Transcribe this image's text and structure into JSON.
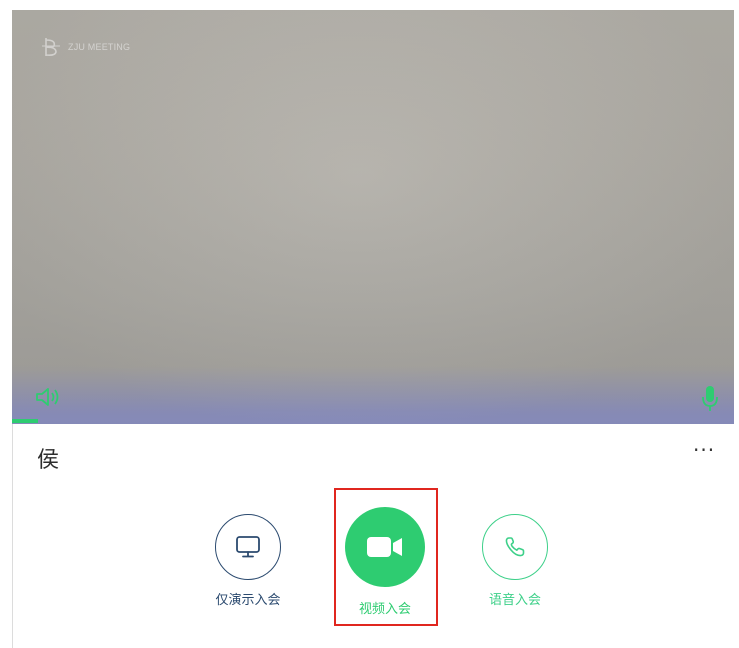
{
  "preview": {
    "logo_text": "ZJU MEETING"
  },
  "user": {
    "name": "侯"
  },
  "more_label": "···",
  "actions": [
    {
      "label": "仅演示入会",
      "icon": "monitor-icon"
    },
    {
      "label": "视频入会",
      "icon": "video-camera-icon"
    },
    {
      "label": "语音入会",
      "icon": "phone-icon"
    }
  ],
  "colors": {
    "primary_green": "#2ecc71",
    "outline_green": "#3dd089",
    "screen_only_blue": "#2b4a6f",
    "highlight_red": "#e0261f"
  }
}
